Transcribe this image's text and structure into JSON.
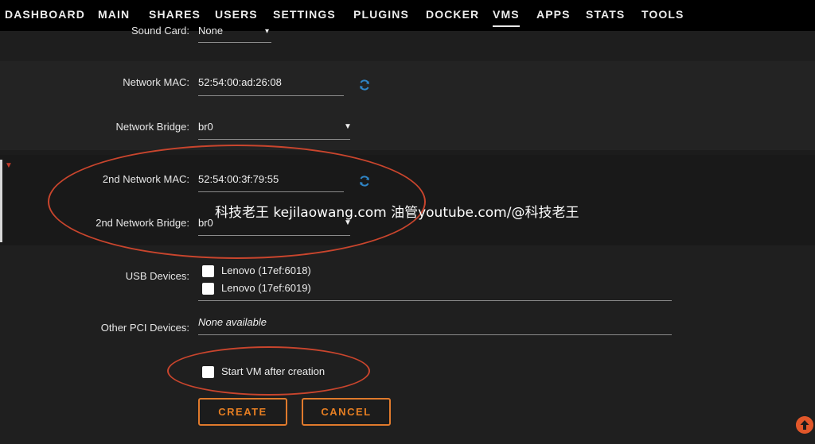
{
  "nav": {
    "items": [
      "DASHBOARD",
      "MAIN",
      "SHARES",
      "USERS",
      "SETTINGS",
      "PLUGINS",
      "DOCKER",
      "VMS",
      "APPS",
      "STATS",
      "TOOLS"
    ],
    "active": "VMS"
  },
  "form": {
    "sound_card": {
      "label": "Sound Card:",
      "value": "None"
    },
    "network_mac": {
      "label": "Network MAC:",
      "value": "52:54:00:ad:26:08"
    },
    "network_bridge": {
      "label": "Network Bridge:",
      "value": "br0"
    },
    "network_mac_2": {
      "label": "2nd Network MAC:",
      "value": "52:54:00:3f:79:55"
    },
    "network_bridge_2": {
      "label": "2nd Network Bridge:",
      "value": "br0"
    },
    "usb_devices": {
      "label": "USB Devices:",
      "items": [
        "Lenovo (17ef:6018)",
        "Lenovo (17ef:6019)"
      ]
    },
    "other_pci": {
      "label": "Other PCI Devices:",
      "value": "None available"
    },
    "start_vm": {
      "label": "Start VM after creation"
    }
  },
  "buttons": {
    "create": "CREATE",
    "cancel": "CANCEL"
  },
  "watermark": "科技老王 kejilaowang.com 油管youtube.com/@科技老王",
  "colors": {
    "accent": "#e67e22",
    "annotation": "#c9452d",
    "refresh": "#2f86c8",
    "background": "#1c1c1c"
  }
}
